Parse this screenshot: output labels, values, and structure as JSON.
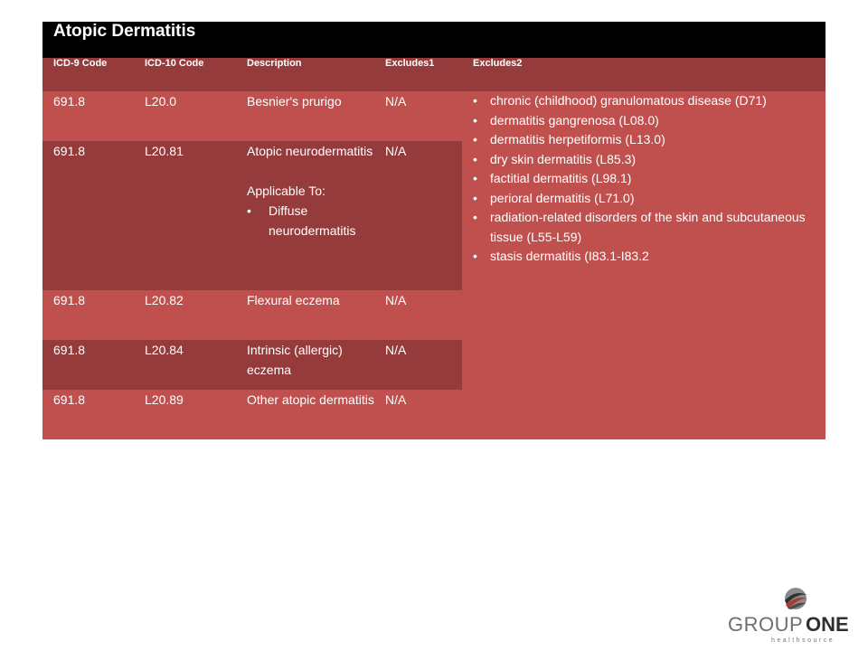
{
  "table": {
    "title": "Atopic Dermatitis",
    "headers": [
      "ICD-9 Code",
      "ICD-10 Code",
      "Description",
      "Excludes1",
      "Excludes2"
    ],
    "rows": [
      {
        "icd9": "691.8",
        "icd10": "L20.0",
        "description": "Besnier's prurigo",
        "excludes1": "N/A"
      },
      {
        "icd9": "691.8",
        "icd10": "L20.81",
        "description": "Atopic neurodermatitis",
        "applicable_label": "Applicable To:",
        "applicable_items": [
          "Diffuse neurodermatitis"
        ],
        "excludes1": "N/A"
      },
      {
        "icd9": "691.8",
        "icd10": "L20.82",
        "description": "Flexural eczema",
        "excludes1": "N/A"
      },
      {
        "icd9": "691.8",
        "icd10": "L20.84",
        "description": "Intrinsic (allergic) eczema",
        "excludes1": "N/A"
      },
      {
        "icd9": "691.8",
        "icd10": "L20.89",
        "description": "Other atopic dermatitis",
        "excludes1": "N/A"
      }
    ],
    "excludes2_items": [
      "chronic (childhood) granulomatous disease (D71)",
      "dermatitis gangrenosa (L08.0)",
      "dermatitis herpetiformis (L13.0)",
      "dry skin dermatitis (L85.3)",
      "factitial dermatitis (L98.1)",
      "perioral dermatitis (L71.0)",
      "radiation-related disorders of the skin and subcutaneous tissue (L55-L59)",
      "stasis dermatitis (I83.1-I83.2"
    ]
  },
  "logo": {
    "text_group": "GROUP",
    "text_one": "ONE",
    "tagline": "healthsource"
  },
  "colors": {
    "title_bg": "#000000",
    "header_bg": "#963b3b",
    "row_light": "#c0504d",
    "row_dark": "#963b3b"
  }
}
